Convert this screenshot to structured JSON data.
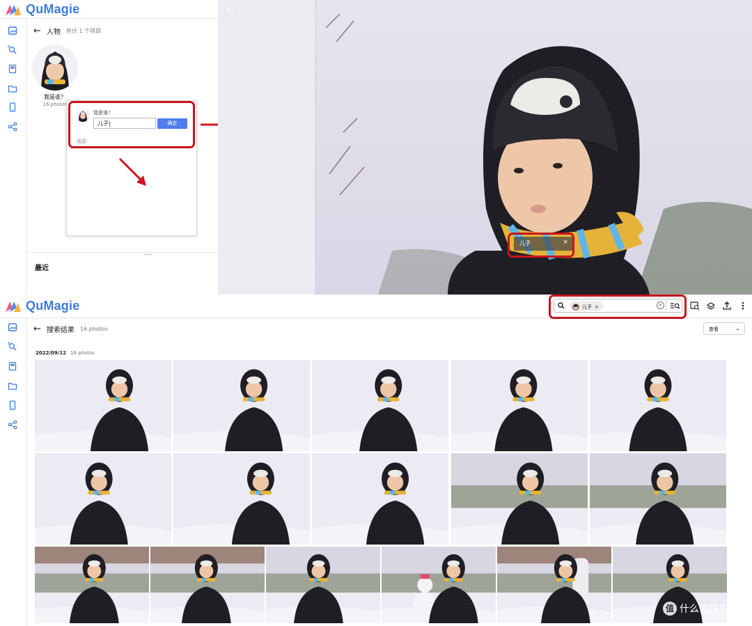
{
  "app": {
    "name": "QuMagie",
    "brand_color": "#3d7be0",
    "highlight_color": "#c8141c"
  },
  "sidebar": {
    "items": [
      {
        "icon": "photos-icon"
      },
      {
        "icon": "ai-search-icon"
      },
      {
        "icon": "album-icon"
      },
      {
        "icon": "folder-icon"
      },
      {
        "icon": "mobile-icon"
      },
      {
        "icon": "share-icon"
      }
    ]
  },
  "people_page": {
    "title": "人物",
    "count": "共计 1 个项目",
    "person_label": "我是谁？",
    "person_photos": "16 photos",
    "recent_label": "最近"
  },
  "name_popup": {
    "question": "我是谁?",
    "input_value": "儿子|",
    "confirm_label": "确定",
    "is_label": "我是:"
  },
  "viewer": {
    "face_tag": "儿子",
    "close_symbol": "×",
    "back_symbol": "←"
  },
  "search_page": {
    "title": "搜索结果",
    "count": "16 photos",
    "search_chip": "儿子",
    "chip_close": "×",
    "clear_symbol": "✕",
    "view_label": "查看",
    "date_label": "2022/09/12",
    "date_count": "16 photos"
  },
  "watermark": {
    "text": "什么值得买",
    "icon_text": "值"
  }
}
